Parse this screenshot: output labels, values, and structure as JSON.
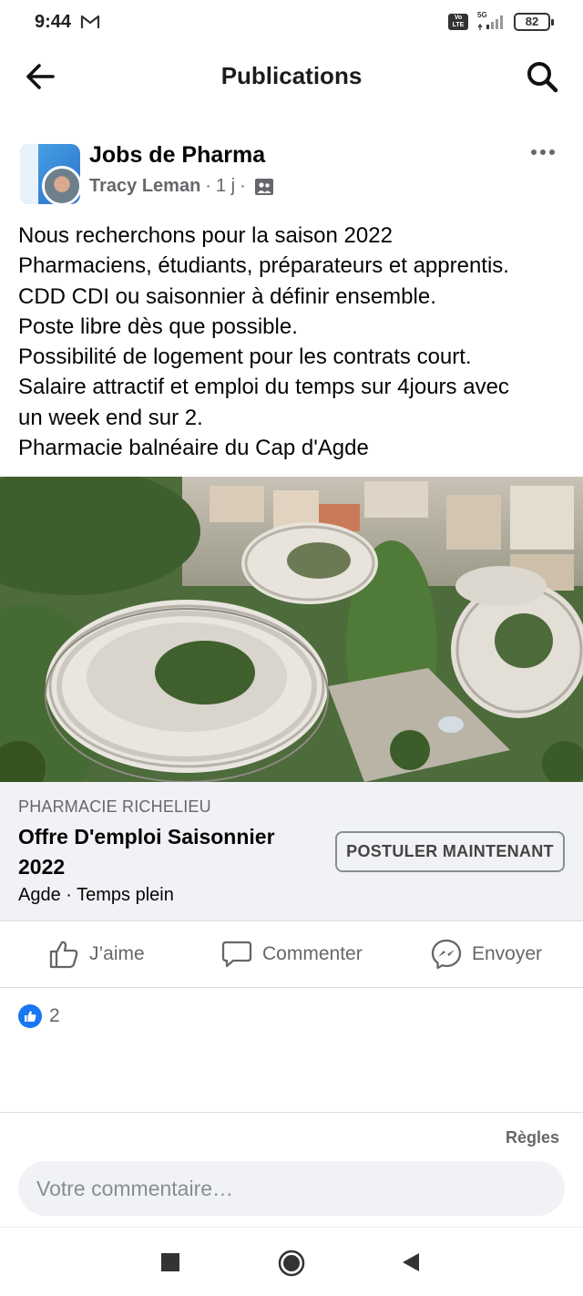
{
  "status_bar": {
    "time": "9:44",
    "network": "5G",
    "volte": "Vo\nLTE",
    "battery": "82"
  },
  "header": {
    "title": "Publications"
  },
  "post": {
    "group_name": "Jobs de Pharma",
    "author": "Tracy Leman",
    "time_ago": "1 j",
    "lines": [
      "Nous recherchons pour la saison 2022",
      "Pharmaciens, étudiants, préparateurs et apprentis.",
      "CDD CDI ou saisonnier à définir ensemble.",
      "Poste libre dès que possible.",
      "Possibilité de logement pour les contrats court.",
      "Salaire attractif et emploi du temps sur 4jours avec",
      "un week end sur 2.",
      "Pharmacie balnéaire du Cap d'Agde"
    ]
  },
  "link_card": {
    "source": "PHARMACIE RICHELIEU",
    "title": "Offre D'emploi Saisonnier 2022",
    "subtitle": "Agde · Temps plein",
    "button_label": "POSTULER MAINTENANT"
  },
  "actions": {
    "like": "J’aime",
    "comment": "Commenter",
    "send": "Envoyer"
  },
  "reactions": {
    "like_count": "2"
  },
  "footer": {
    "rules": "Règles",
    "comment_placeholder": "Votre commentaire…"
  },
  "colors": {
    "facebook_blue": "#1877f2",
    "secondary_text": "#65676b",
    "card_bg": "#f0f2f5"
  }
}
